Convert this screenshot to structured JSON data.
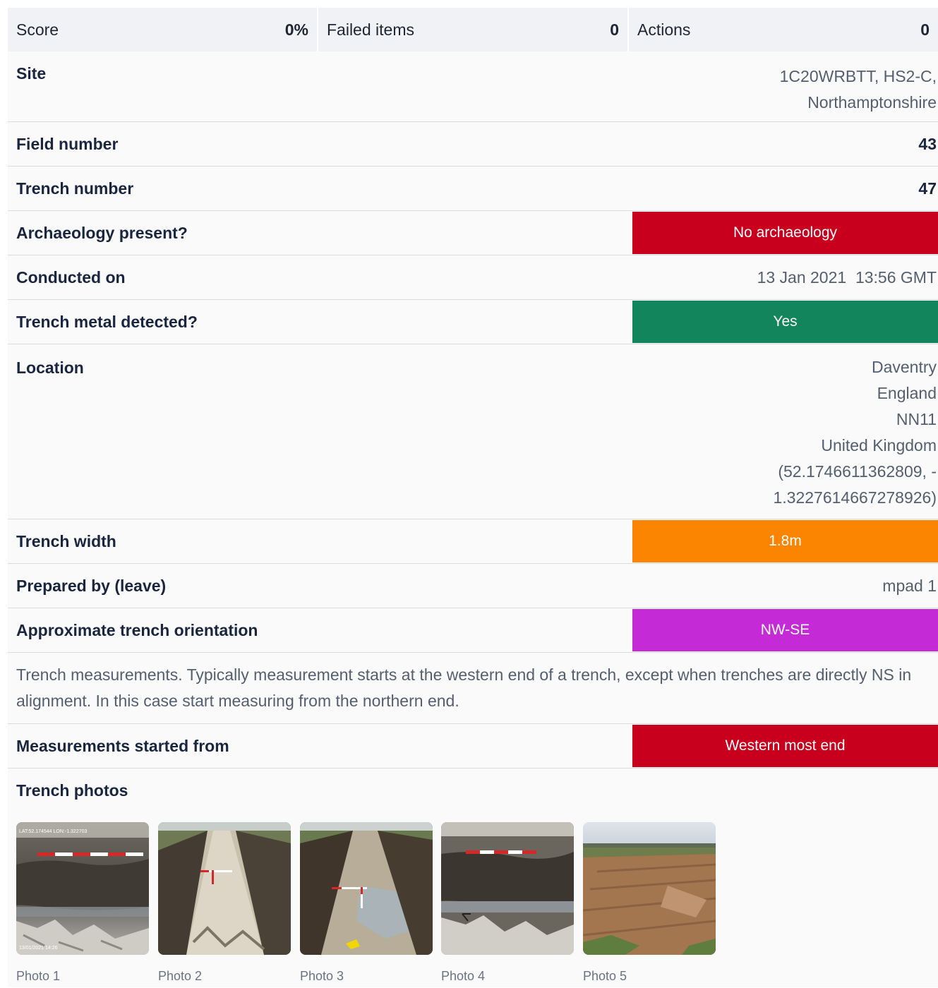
{
  "summary": {
    "score_label": "Score",
    "score_value": "0%",
    "failed_label": "Failed items",
    "failed_value": "0",
    "actions_label": "Actions",
    "actions_value": "0"
  },
  "fields": {
    "site": {
      "label": "Site",
      "value_line1": "1C20WRBTT, HS2-C,",
      "value_line2": "Northamptonshire"
    },
    "field_number": {
      "label": "Field number",
      "value": "43"
    },
    "trench_number": {
      "label": "Trench number",
      "value": "47"
    },
    "archaeology": {
      "label": "Archaeology present?",
      "value": "No archaeology",
      "color": "#c8001e"
    },
    "conducted_on": {
      "label": "Conducted on",
      "value": "13 Jan 2021  13:56 GMT"
    },
    "metal_detected": {
      "label": "Trench metal detected?",
      "value": "Yes",
      "color": "#13855c"
    },
    "location": {
      "label": "Location",
      "lines": [
        "Daventry",
        "England",
        "NN11",
        "United Kingdom",
        "(52.1746611362809, -",
        "1.3227614667278926)"
      ]
    },
    "trench_width": {
      "label": "Trench width",
      "value": "1.8m",
      "color": "#fb8500"
    },
    "prepared_by": {
      "label": "Prepared by (leave)",
      "value": "mpad 1"
    },
    "orientation": {
      "label": "Approximate trench orientation",
      "value": "NW-SE",
      "color": "#c42bd6"
    },
    "measurement_note": "Trench measurements. Typically measurement starts at the western end of a trench, except when trenches are directly NS in alignment. In this case start measuring from the northern end.",
    "measurements_started": {
      "label": "Measurements started from",
      "value": "Western most end",
      "color": "#c8001e"
    }
  },
  "photos": {
    "label": "Trench photos",
    "items": [
      {
        "caption": "Photo 1",
        "overlay_top": "LAT:52.174544 LON:-1.322703",
        "overlay_bottom": "13/01/2021 14:26"
      },
      {
        "caption": "Photo 2"
      },
      {
        "caption": "Photo 3"
      },
      {
        "caption": "Photo 4"
      },
      {
        "caption": "Photo 5"
      }
    ]
  }
}
